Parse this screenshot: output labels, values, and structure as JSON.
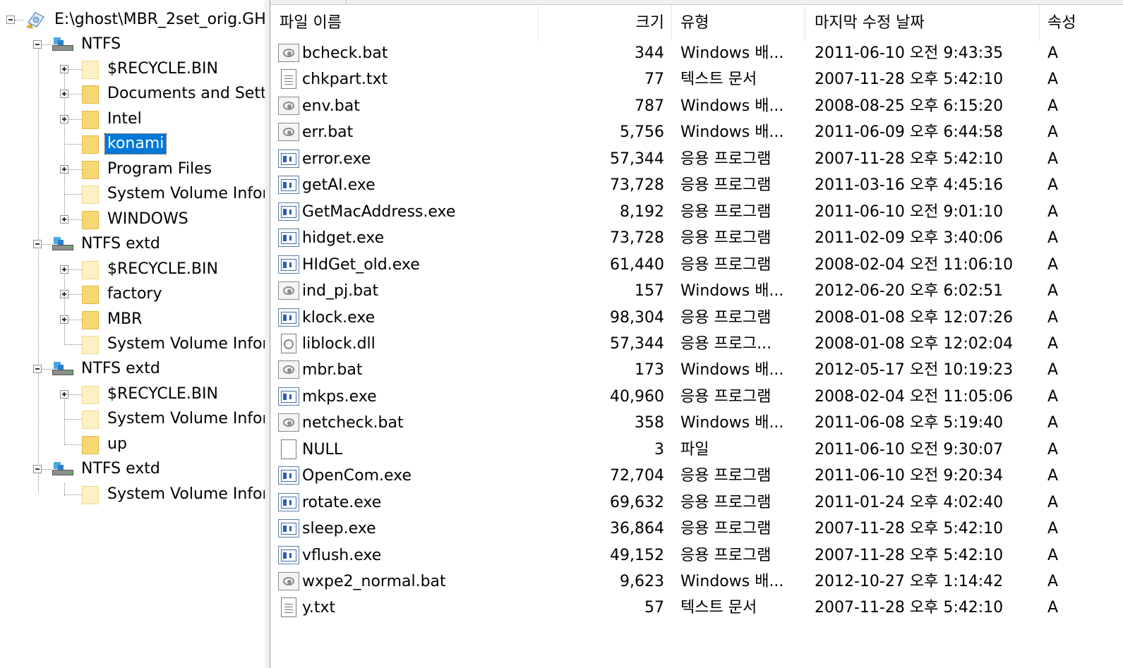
{
  "tree": {
    "root_label": "E:\\ghost\\MBR_2set_orig.GH",
    "nodes": [
      {
        "label": "NTFS",
        "kind": "drive",
        "expander": "minus"
      },
      {
        "label": "$RECYCLE.BIN",
        "kind": "folder-pale",
        "expander": "plus"
      },
      {
        "label": "Documents and Settings",
        "kind": "folder",
        "expander": "plus"
      },
      {
        "label": "Intel",
        "kind": "folder",
        "expander": "plus"
      },
      {
        "label": "konami",
        "kind": "folder",
        "expander": "none",
        "selected": true
      },
      {
        "label": "Program Files",
        "kind": "folder",
        "expander": "plus"
      },
      {
        "label": "System Volume Information",
        "kind": "folder-pale",
        "expander": "none"
      },
      {
        "label": "WINDOWS",
        "kind": "folder",
        "expander": "plus"
      },
      {
        "label": "NTFS extd",
        "kind": "drive",
        "expander": "minus"
      },
      {
        "label": "$RECYCLE.BIN",
        "kind": "folder-pale",
        "expander": "plus"
      },
      {
        "label": "factory",
        "kind": "folder",
        "expander": "plus"
      },
      {
        "label": "MBR",
        "kind": "folder",
        "expander": "plus"
      },
      {
        "label": "System Volume Information",
        "kind": "folder-pale",
        "expander": "none"
      },
      {
        "label": "NTFS extd",
        "kind": "drive",
        "expander": "minus"
      },
      {
        "label": "$RECYCLE.BIN",
        "kind": "folder-pale",
        "expander": "plus"
      },
      {
        "label": "System Volume Information",
        "kind": "folder-pale",
        "expander": "none"
      },
      {
        "label": "up",
        "kind": "folder",
        "expander": "none"
      },
      {
        "label": "NTFS extd",
        "kind": "drive",
        "expander": "minus"
      },
      {
        "label": "System Volume Information",
        "kind": "folder-pale",
        "expander": "none"
      }
    ]
  },
  "list": {
    "columns": {
      "name": "파일 이름",
      "size": "크기",
      "type": "유형",
      "date": "마지막 수정 날짜",
      "attr": "속성"
    },
    "files": [
      {
        "name": "bcheck.bat",
        "size": "344",
        "type": "Windows 배...",
        "date": "2011-06-10 오전 9:43:35",
        "attr": "A",
        "icon": "bat"
      },
      {
        "name": "chkpart.txt",
        "size": "77",
        "type": "텍스트 문서",
        "date": "2007-11-28 오후 5:42:10",
        "attr": "A",
        "icon": "txt"
      },
      {
        "name": "env.bat",
        "size": "787",
        "type": "Windows 배...",
        "date": "2008-08-25 오후 6:15:20",
        "attr": "A",
        "icon": "bat"
      },
      {
        "name": "err.bat",
        "size": "5,756",
        "type": "Windows 배...",
        "date": "2011-06-09 오후 6:44:58",
        "attr": "A",
        "icon": "bat"
      },
      {
        "name": "error.exe",
        "size": "57,344",
        "type": "응용 프로그램",
        "date": "2007-11-28 오후 5:42:10",
        "attr": "A",
        "icon": "exe"
      },
      {
        "name": "getAI.exe",
        "size": "73,728",
        "type": "응용 프로그램",
        "date": "2011-03-16 오후 4:45:16",
        "attr": "A",
        "icon": "exe"
      },
      {
        "name": "GetMacAddress.exe",
        "size": "8,192",
        "type": "응용 프로그램",
        "date": "2011-06-10 오전 9:01:10",
        "attr": "A",
        "icon": "exe"
      },
      {
        "name": "hidget.exe",
        "size": "73,728",
        "type": "응용 프로그램",
        "date": "2011-02-09 오후 3:40:06",
        "attr": "A",
        "icon": "exe"
      },
      {
        "name": "HIdGet_old.exe",
        "size": "61,440",
        "type": "응용 프로그램",
        "date": "2008-02-04 오전 11:06:10",
        "attr": "A",
        "icon": "exe"
      },
      {
        "name": "ind_pj.bat",
        "size": "157",
        "type": "Windows 배...",
        "date": "2012-06-20 오후 6:02:51",
        "attr": "A",
        "icon": "bat"
      },
      {
        "name": "klock.exe",
        "size": "98,304",
        "type": "응용 프로그램",
        "date": "2008-01-08 오후 12:07:26",
        "attr": "A",
        "icon": "exe"
      },
      {
        "name": "liblock.dll",
        "size": "57,344",
        "type": "응용 프로그...",
        "date": "2008-01-08 오후 12:02:04",
        "attr": "A",
        "icon": "dll"
      },
      {
        "name": "mbr.bat",
        "size": "173",
        "type": "Windows 배...",
        "date": "2012-05-17 오전 10:19:23",
        "attr": "A",
        "icon": "bat"
      },
      {
        "name": "mkps.exe",
        "size": "40,960",
        "type": "응용 프로그램",
        "date": "2008-02-04 오전 11:05:06",
        "attr": "A",
        "icon": "exe"
      },
      {
        "name": "netcheck.bat",
        "size": "358",
        "type": "Windows 배...",
        "date": "2011-06-08 오후 5:19:40",
        "attr": "A",
        "icon": "bat"
      },
      {
        "name": "NULL",
        "size": "3",
        "type": "파일",
        "date": "2011-06-10 오전 9:30:07",
        "attr": "A",
        "icon": "blank"
      },
      {
        "name": "OpenCom.exe",
        "size": "72,704",
        "type": "응용 프로그램",
        "date": "2011-06-10 오전 9:20:34",
        "attr": "A",
        "icon": "exe"
      },
      {
        "name": "rotate.exe",
        "size": "69,632",
        "type": "응용 프로그램",
        "date": "2011-01-24 오후 4:02:40",
        "attr": "A",
        "icon": "exe"
      },
      {
        "name": "sleep.exe",
        "size": "36,864",
        "type": "응용 프로그램",
        "date": "2007-11-28 오후 5:42:10",
        "attr": "A",
        "icon": "exe"
      },
      {
        "name": "vflush.exe",
        "size": "49,152",
        "type": "응용 프로그램",
        "date": "2007-11-28 오후 5:42:10",
        "attr": "A",
        "icon": "exe"
      },
      {
        "name": "wxpe2_normal.bat",
        "size": "9,623",
        "type": "Windows 배...",
        "date": "2012-10-27 오후 1:14:42",
        "attr": "A",
        "icon": "bat"
      },
      {
        "name": "y.txt",
        "size": "57",
        "type": "텍스트 문서",
        "date": "2007-11-28 오후 5:42:10",
        "attr": "A",
        "icon": "txt"
      }
    ]
  }
}
